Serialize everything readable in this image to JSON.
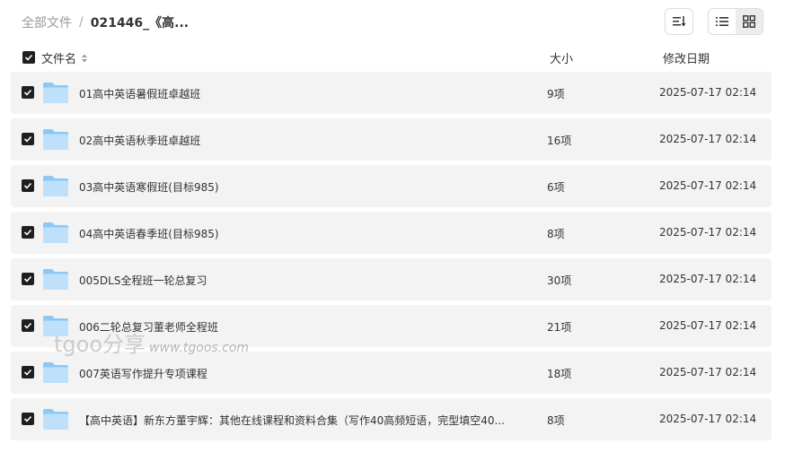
{
  "breadcrumb": {
    "root": "全部文件",
    "separator": "/",
    "current": "021446_《高..."
  },
  "toolbar": {
    "sort_icon": "sort-list-icon",
    "list_view_icon": "list-view-icon",
    "grid_view_icon": "grid-view-icon",
    "active_view": "grid"
  },
  "columns": {
    "name": "文件名",
    "size": "大小",
    "date": "修改日期"
  },
  "files": [
    {
      "name": "01高中英语暑假班卓越班",
      "size": "9项",
      "date": "2025-07-17 02:14",
      "checked": true
    },
    {
      "name": "02高中英语秋季班卓越班",
      "size": "16项",
      "date": "2025-07-17 02:14",
      "checked": true
    },
    {
      "name": "03高中英语寒假班(目标985)",
      "size": "6项",
      "date": "2025-07-17 02:14",
      "checked": true
    },
    {
      "name": "04高中英语春季班(目标985)",
      "size": "8项",
      "date": "2025-07-17 02:14",
      "checked": true
    },
    {
      "name": "005DLS全程班一轮总复习",
      "size": "30项",
      "date": "2025-07-17 02:14",
      "checked": true
    },
    {
      "name": "006二轮总复习董老师全程班",
      "size": "21项",
      "date": "2025-07-17 02:14",
      "checked": true
    },
    {
      "name": "007英语写作提升专项课程",
      "size": "18项",
      "date": "2025-07-17 02:14",
      "checked": true
    },
    {
      "name": "【高中英语】新东方董宇辉：其他在线课程和资料合集（写作40高频短语，完型填空40...",
      "size": "8项",
      "date": "2025-07-17 02:14",
      "checked": true
    }
  ],
  "watermark": {
    "logo": "tgoo分享",
    "url": "www.tgoos.com"
  },
  "colors": {
    "row_bg": "#f3f3f3",
    "checkbox": "#1f1f1f",
    "folder_light": "#bfe0fb",
    "folder_dark": "#8cc8f5"
  }
}
